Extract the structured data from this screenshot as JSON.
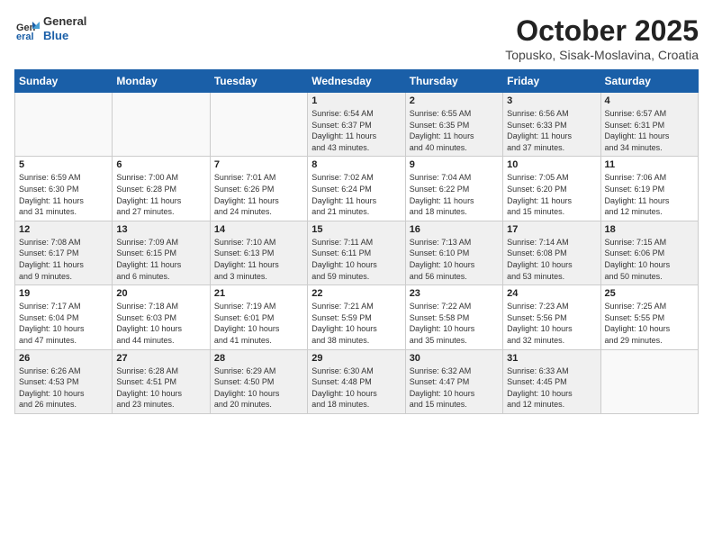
{
  "header": {
    "logo_general": "General",
    "logo_blue": "Blue",
    "month": "October 2025",
    "location": "Topusko, Sisak-Moslavina, Croatia"
  },
  "weekdays": [
    "Sunday",
    "Monday",
    "Tuesday",
    "Wednesday",
    "Thursday",
    "Friday",
    "Saturday"
  ],
  "weeks": [
    [
      {
        "day": "",
        "info": ""
      },
      {
        "day": "",
        "info": ""
      },
      {
        "day": "",
        "info": ""
      },
      {
        "day": "1",
        "info": "Sunrise: 6:54 AM\nSunset: 6:37 PM\nDaylight: 11 hours\nand 43 minutes."
      },
      {
        "day": "2",
        "info": "Sunrise: 6:55 AM\nSunset: 6:35 PM\nDaylight: 11 hours\nand 40 minutes."
      },
      {
        "day": "3",
        "info": "Sunrise: 6:56 AM\nSunset: 6:33 PM\nDaylight: 11 hours\nand 37 minutes."
      },
      {
        "day": "4",
        "info": "Sunrise: 6:57 AM\nSunset: 6:31 PM\nDaylight: 11 hours\nand 34 minutes."
      }
    ],
    [
      {
        "day": "5",
        "info": "Sunrise: 6:59 AM\nSunset: 6:30 PM\nDaylight: 11 hours\nand 31 minutes."
      },
      {
        "day": "6",
        "info": "Sunrise: 7:00 AM\nSunset: 6:28 PM\nDaylight: 11 hours\nand 27 minutes."
      },
      {
        "day": "7",
        "info": "Sunrise: 7:01 AM\nSunset: 6:26 PM\nDaylight: 11 hours\nand 24 minutes."
      },
      {
        "day": "8",
        "info": "Sunrise: 7:02 AM\nSunset: 6:24 PM\nDaylight: 11 hours\nand 21 minutes."
      },
      {
        "day": "9",
        "info": "Sunrise: 7:04 AM\nSunset: 6:22 PM\nDaylight: 11 hours\nand 18 minutes."
      },
      {
        "day": "10",
        "info": "Sunrise: 7:05 AM\nSunset: 6:20 PM\nDaylight: 11 hours\nand 15 minutes."
      },
      {
        "day": "11",
        "info": "Sunrise: 7:06 AM\nSunset: 6:19 PM\nDaylight: 11 hours\nand 12 minutes."
      }
    ],
    [
      {
        "day": "12",
        "info": "Sunrise: 7:08 AM\nSunset: 6:17 PM\nDaylight: 11 hours\nand 9 minutes."
      },
      {
        "day": "13",
        "info": "Sunrise: 7:09 AM\nSunset: 6:15 PM\nDaylight: 11 hours\nand 6 minutes."
      },
      {
        "day": "14",
        "info": "Sunrise: 7:10 AM\nSunset: 6:13 PM\nDaylight: 11 hours\nand 3 minutes."
      },
      {
        "day": "15",
        "info": "Sunrise: 7:11 AM\nSunset: 6:11 PM\nDaylight: 10 hours\nand 59 minutes."
      },
      {
        "day": "16",
        "info": "Sunrise: 7:13 AM\nSunset: 6:10 PM\nDaylight: 10 hours\nand 56 minutes."
      },
      {
        "day": "17",
        "info": "Sunrise: 7:14 AM\nSunset: 6:08 PM\nDaylight: 10 hours\nand 53 minutes."
      },
      {
        "day": "18",
        "info": "Sunrise: 7:15 AM\nSunset: 6:06 PM\nDaylight: 10 hours\nand 50 minutes."
      }
    ],
    [
      {
        "day": "19",
        "info": "Sunrise: 7:17 AM\nSunset: 6:04 PM\nDaylight: 10 hours\nand 47 minutes."
      },
      {
        "day": "20",
        "info": "Sunrise: 7:18 AM\nSunset: 6:03 PM\nDaylight: 10 hours\nand 44 minutes."
      },
      {
        "day": "21",
        "info": "Sunrise: 7:19 AM\nSunset: 6:01 PM\nDaylight: 10 hours\nand 41 minutes."
      },
      {
        "day": "22",
        "info": "Sunrise: 7:21 AM\nSunset: 5:59 PM\nDaylight: 10 hours\nand 38 minutes."
      },
      {
        "day": "23",
        "info": "Sunrise: 7:22 AM\nSunset: 5:58 PM\nDaylight: 10 hours\nand 35 minutes."
      },
      {
        "day": "24",
        "info": "Sunrise: 7:23 AM\nSunset: 5:56 PM\nDaylight: 10 hours\nand 32 minutes."
      },
      {
        "day": "25",
        "info": "Sunrise: 7:25 AM\nSunset: 5:55 PM\nDaylight: 10 hours\nand 29 minutes."
      }
    ],
    [
      {
        "day": "26",
        "info": "Sunrise: 6:26 AM\nSunset: 4:53 PM\nDaylight: 10 hours\nand 26 minutes."
      },
      {
        "day": "27",
        "info": "Sunrise: 6:28 AM\nSunset: 4:51 PM\nDaylight: 10 hours\nand 23 minutes."
      },
      {
        "day": "28",
        "info": "Sunrise: 6:29 AM\nSunset: 4:50 PM\nDaylight: 10 hours\nand 20 minutes."
      },
      {
        "day": "29",
        "info": "Sunrise: 6:30 AM\nSunset: 4:48 PM\nDaylight: 10 hours\nand 18 minutes."
      },
      {
        "day": "30",
        "info": "Sunrise: 6:32 AM\nSunset: 4:47 PM\nDaylight: 10 hours\nand 15 minutes."
      },
      {
        "day": "31",
        "info": "Sunrise: 6:33 AM\nSunset: 4:45 PM\nDaylight: 10 hours\nand 12 minutes."
      },
      {
        "day": "",
        "info": ""
      }
    ]
  ]
}
